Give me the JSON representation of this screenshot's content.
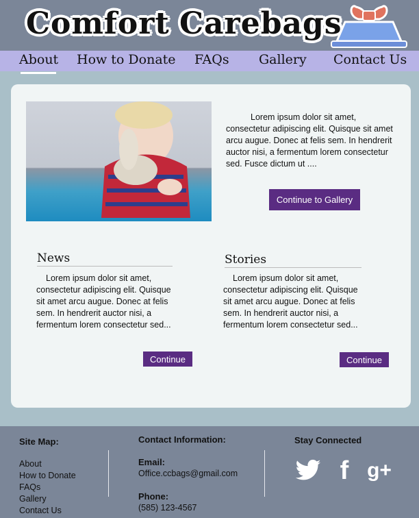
{
  "header": {
    "logo_word1": "Comfort",
    "logo_word2": "Carebags"
  },
  "nav": {
    "items": [
      "About",
      "How to Donate",
      "FAQs",
      "Gallery",
      "Contact Us"
    ],
    "active": "About"
  },
  "intro": {
    "text": "Lorem ipsum dolor sit amet, consectetur adipiscing elit. Quisque sit amet arcu augue. Donec at felis sem. In hendrerit auctor nisi, a fermentum lorem consectetur sed. Fusce dictum ut ....",
    "button_label": "Continue to Gallery"
  },
  "news": {
    "title": "News",
    "text": "Lorem ipsum dolor sit amet, consectetur adipiscing elit. Quisque sit amet arcu augue. Donec at felis sem. In hendrerit auctor nisi, a fermentum lorem consectetur sed...",
    "button_label": "Continue"
  },
  "stories": {
    "title": "Stories",
    "text": "Lorem ipsum dolor sit amet, consectetur adipiscing elit. Quisque sit amet arcu augue. Donec at felis sem. In hendrerit auctor nisi, a fermentum lorem consectetur sed...",
    "button_label": "Continue"
  },
  "footer": {
    "sitemap_title": "Site Map:",
    "sitemap_links": [
      "About",
      "How to Donate",
      "FAQs",
      "Gallery",
      "Contact Us"
    ],
    "contact_title": "Contact Information:",
    "email_label": "Email:",
    "email": "Office.ccbags@gmail.com",
    "phone_label": "Phone:",
    "phone": "(585) 123-4567",
    "connect_title": "Stay Connected",
    "social": [
      "twitter-icon",
      "facebook-icon",
      "google-plus-icon"
    ]
  },
  "colors": {
    "header_bg": "#7b8698",
    "nav_bg": "#b7b3e6",
    "button": "#5a2c82",
    "panel": "#f1f5f5"
  }
}
